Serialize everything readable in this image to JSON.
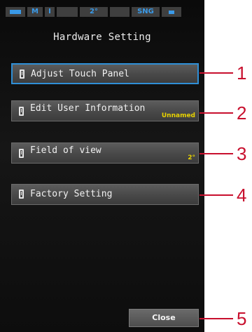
{
  "statusbar": {
    "mode_icon": "meter-icon",
    "segment1": "M",
    "segment2": "I",
    "angle": "2°",
    "sng": "SNG",
    "battery_icon": "battery-icon"
  },
  "screen": {
    "title": "Hardware Setting"
  },
  "menu": [
    {
      "label": "Adjust Touch Panel",
      "value": "",
      "icon": "menu-item-icon",
      "selected": true
    },
    {
      "label": "Edit User Information",
      "value": "Unnamed",
      "icon": "menu-item-icon",
      "selected": false
    },
    {
      "label": "Field of view",
      "value": "2°",
      "icon": "menu-item-icon",
      "selected": false
    },
    {
      "label": "Factory Setting",
      "value": "",
      "icon": "menu-item-icon",
      "selected": false
    }
  ],
  "close_label": "Close",
  "callouts": [
    "1",
    "2",
    "3",
    "4",
    "5"
  ],
  "colors": {
    "selected_border": "#2f8fd6",
    "value_text": "#e8d200",
    "callout": "#c8102e"
  }
}
